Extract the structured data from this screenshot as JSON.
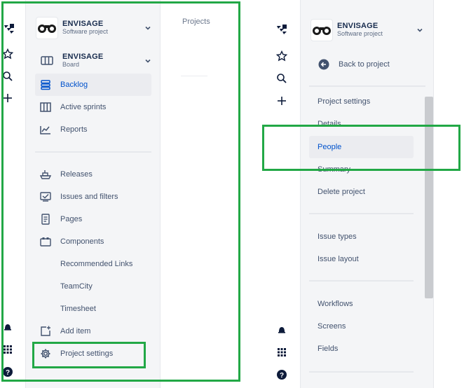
{
  "project": {
    "name": "ENVISAGE",
    "type": "Software project"
  },
  "board": {
    "name": "ENVISAGE",
    "type": "Board"
  },
  "left_nav": {
    "planning": [
      {
        "label": "Backlog",
        "icon": "backlog-icon",
        "selected": true
      },
      {
        "label": "Active sprints",
        "icon": "active-sprints-icon"
      },
      {
        "label": "Reports",
        "icon": "reports-icon"
      }
    ],
    "development": [
      {
        "label": "Releases",
        "icon": "ship-icon"
      },
      {
        "label": "Issues and filters",
        "icon": "issues-icon"
      },
      {
        "label": "Pages",
        "icon": "page-icon"
      },
      {
        "label": "Components",
        "icon": "components-icon"
      },
      {
        "label": "Recommended Links"
      },
      {
        "label": "TeamCity"
      },
      {
        "label": "Timesheet"
      },
      {
        "label": "Add item",
        "icon": "add-item-icon"
      },
      {
        "label": "Project settings",
        "icon": "gear-icon"
      }
    ]
  },
  "content": {
    "breadcrumb": "Projects"
  },
  "settings_nav": {
    "back_label": "Back to project",
    "section_title": "Project settings",
    "group1": [
      "Details",
      "People",
      "Summary",
      "Delete project"
    ],
    "group2": [
      "Issue types",
      "Issue layout"
    ],
    "group3": [
      "Workflows",
      "Screens",
      "Fields"
    ]
  },
  "colors": {
    "accent": "#0052cc",
    "highlight": "#22a846",
    "sidebar_bg": "#f4f5f7"
  }
}
